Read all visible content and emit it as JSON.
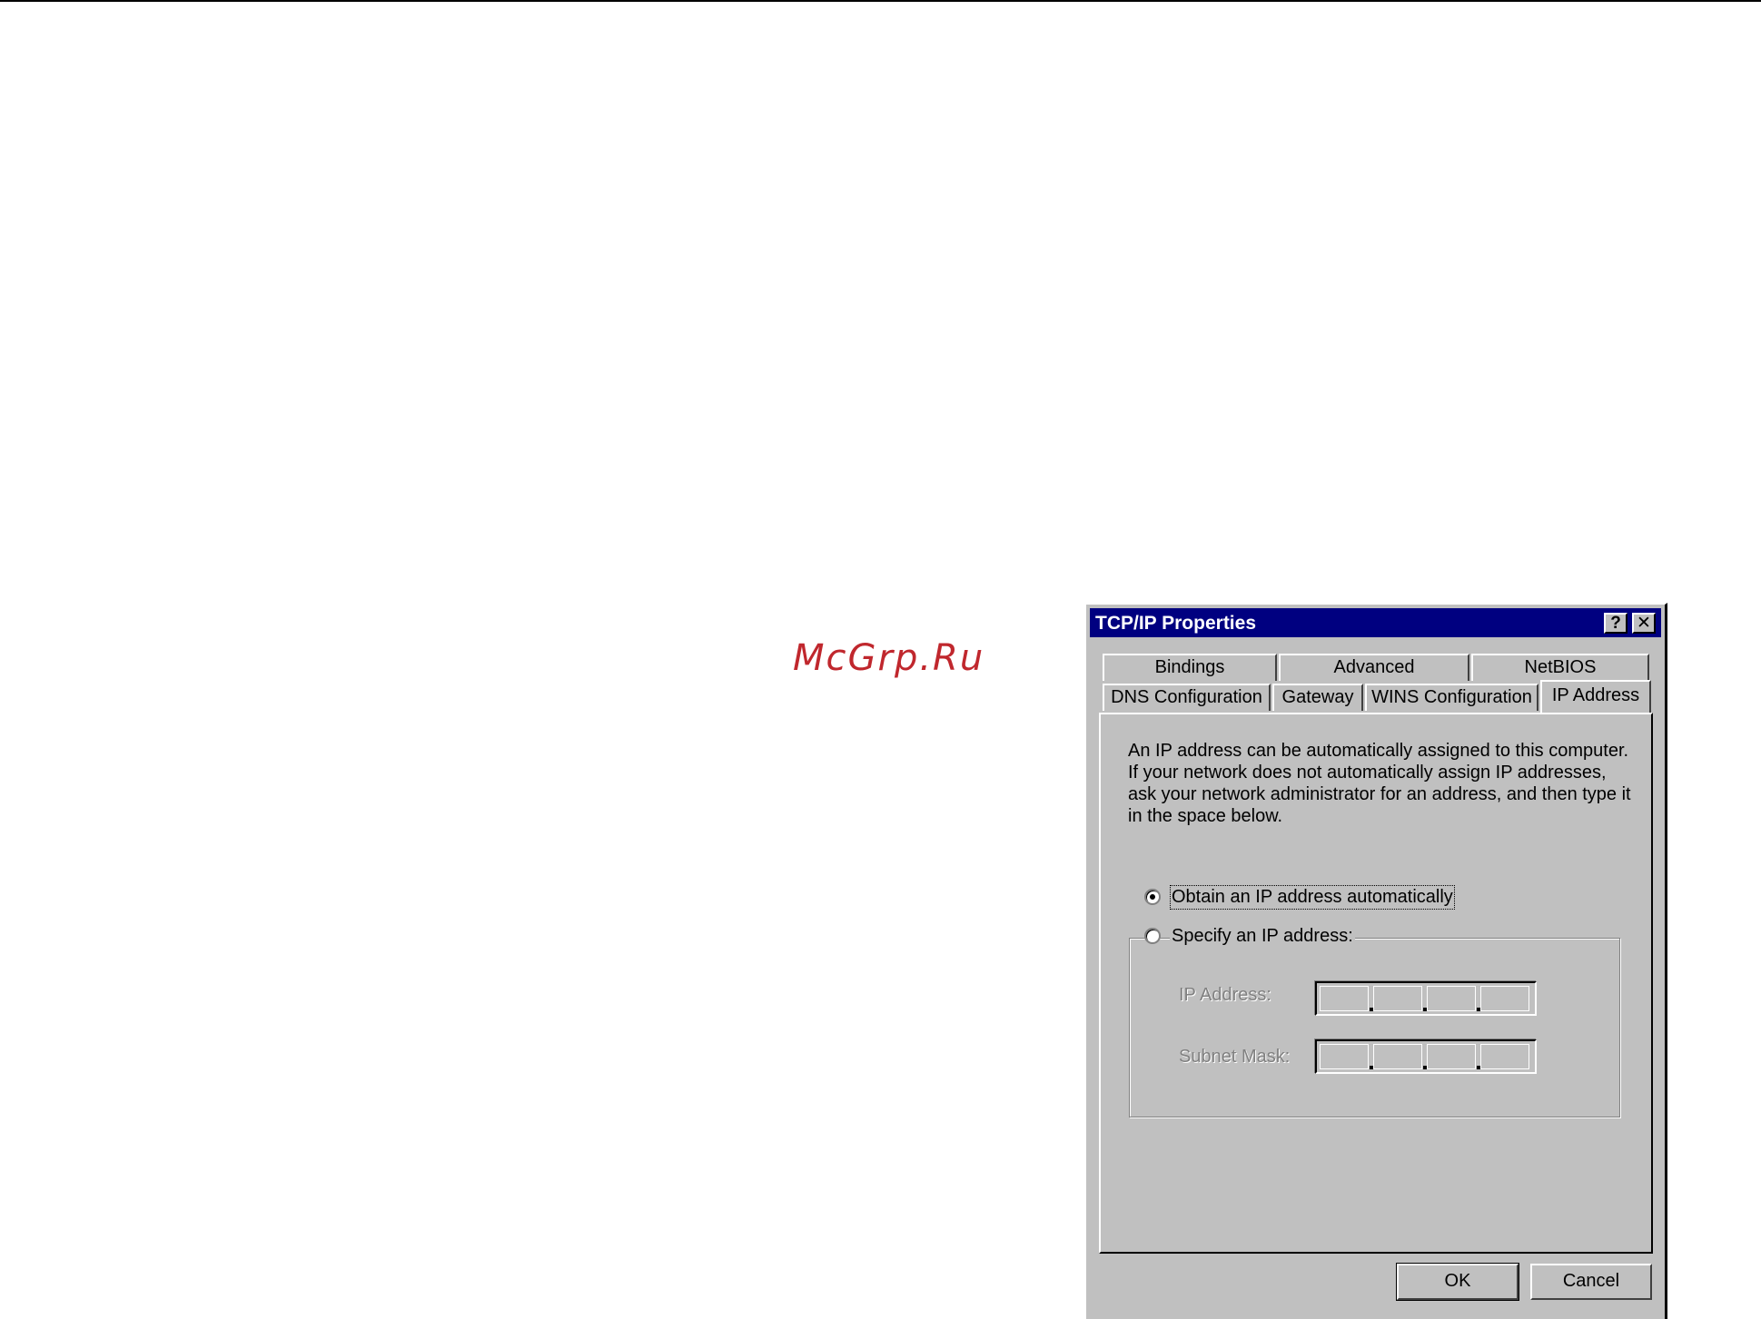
{
  "watermark": "McGrp.Ru",
  "dialog": {
    "title": "TCP/IP Properties",
    "help_button": "?",
    "close_button": "✕",
    "tabs_row1": [
      "Bindings",
      "Advanced",
      "NetBIOS"
    ],
    "tabs_row2": [
      "DNS Configuration",
      "Gateway",
      "WINS Configuration",
      "IP Address"
    ],
    "selected_tab": "IP Address",
    "description": "An IP address can be automatically assigned to this computer. If your network does not automatically assign IP addresses, ask your network administrator for an address, and then type it in the space below.",
    "options": {
      "obtain_label": "Obtain an IP address automatically",
      "obtain_selected": true,
      "specify_label": "Specify an IP address:",
      "specify_selected": false
    },
    "fields": {
      "ip_address_label": "IP Address:",
      "ip_address_value": [
        "",
        "",
        "",
        ""
      ],
      "subnet_mask_label": "Subnet Mask:",
      "subnet_mask_value": [
        "",
        "",
        "",
        ""
      ]
    },
    "ok_label": "OK",
    "cancel_label": "Cancel"
  },
  "icons": {
    "help": "question-mark-icon",
    "close": "close-icon"
  },
  "colors": {
    "titlebar": "#000080",
    "face": "#c0c0c0",
    "watermark": "#c0272d"
  }
}
